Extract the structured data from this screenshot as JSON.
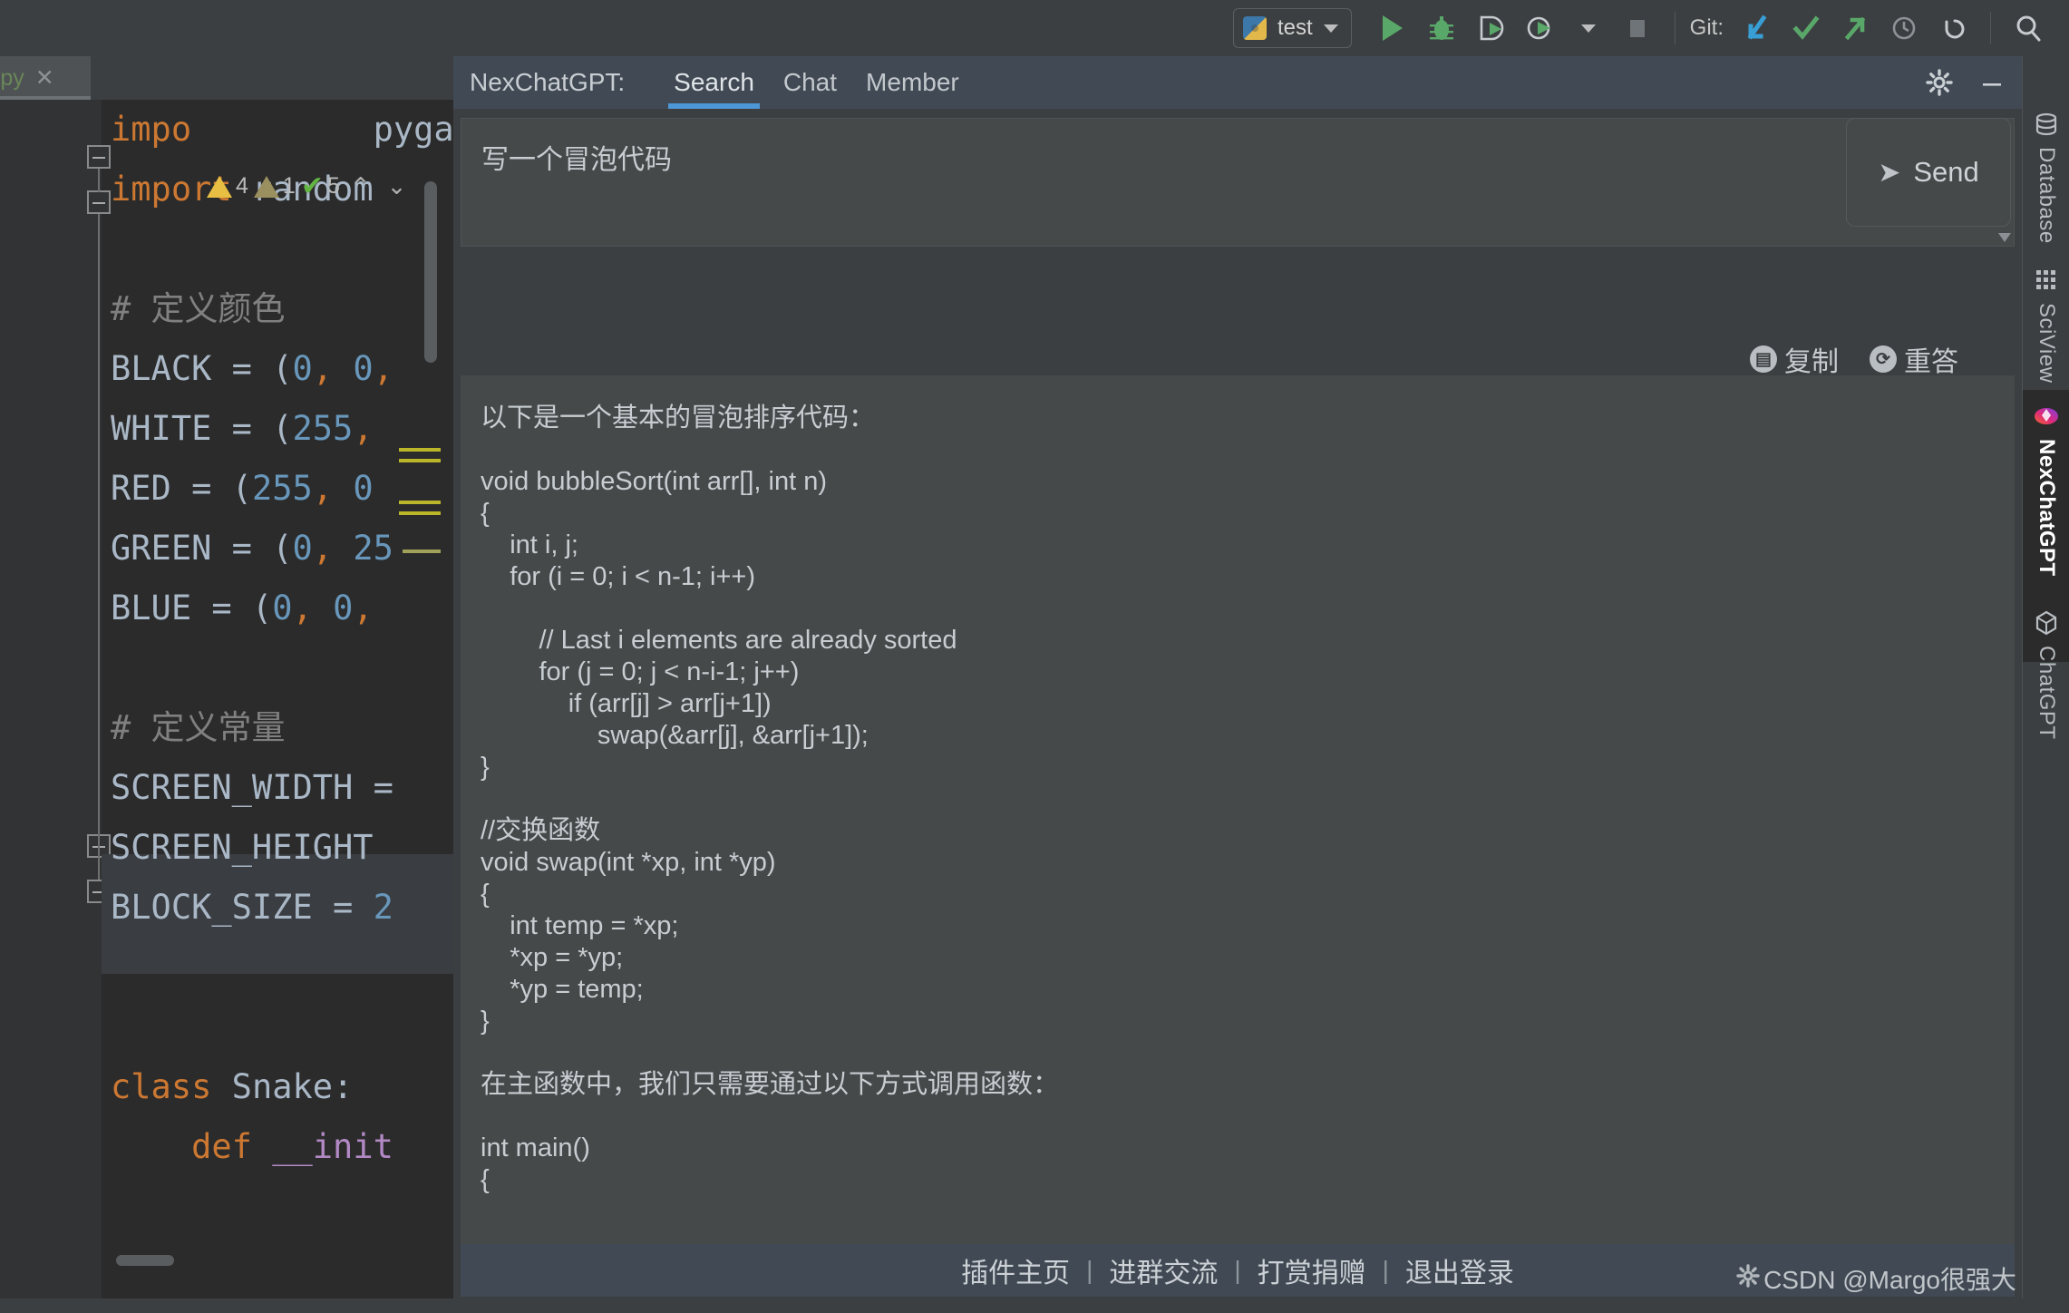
{
  "toolbar": {
    "run_config_label": "test",
    "git_label": "Git:",
    "icons": [
      {
        "name": "python-logo",
        "glyph": "py"
      },
      {
        "name": "run-button",
        "glyph": "▶"
      },
      {
        "name": "debug-button",
        "glyph": "bug"
      },
      {
        "name": "run-coverage-button",
        "glyph": "shield-run"
      },
      {
        "name": "profile-button",
        "glyph": "clock-run"
      },
      {
        "name": "stop-button",
        "glyph": "■"
      },
      {
        "name": "git-update-project",
        "glyph": "↙"
      },
      {
        "name": "git-commit",
        "glyph": "✓"
      },
      {
        "name": "git-push",
        "glyph": "↗"
      },
      {
        "name": "git-history",
        "glyph": "◷"
      },
      {
        "name": "git-rollback",
        "glyph": "↺"
      },
      {
        "name": "search-everywhere",
        "glyph": "⌕"
      }
    ]
  },
  "editor": {
    "tab_name": "st.py",
    "tab_close": "✕",
    "inspections": {
      "warnings": "4",
      "weak_warnings": "1",
      "checks": "5",
      "prev": "⌃",
      "next": "⌄"
    },
    "code_lines": [
      "impo         pyga   e",
      "import random",
      "",
      "# 定义颜色",
      "BLACK = (0, 0,",
      "WHITE = (255,",
      "RED = (255, 0",
      "GREEN = (0, 25",
      "BLUE = (0, 0,",
      "",
      "# 定义常量",
      "SCREEN_WIDTH =",
      "SCREEN_HEIGHT",
      "BLOCK_SIZE = 2",
      "",
      "",
      "class Snake:",
      "    def __init"
    ]
  },
  "panel": {
    "title": "NexChatGPT:",
    "tabs": [
      {
        "label": "Search",
        "active": true
      },
      {
        "label": "Chat",
        "active": false
      },
      {
        "label": "Member",
        "active": false
      }
    ],
    "settings_icon": "gear-icon",
    "minimize_icon": "minimize-icon",
    "input_value": "写一个冒泡代码",
    "input_placeholder": "",
    "send_label": "Send",
    "send_icon": "➤",
    "actions": [
      {
        "label": "复制",
        "icon": "copy-icon",
        "glyph": "▤"
      },
      {
        "label": "重答",
        "icon": "refresh-icon",
        "glyph": "⟳"
      }
    ],
    "answer_text": "以下是一个基本的冒泡排序代码：\n\nvoid bubbleSort(int arr[], int n)\n{\n    int i, j;\n    for (i = 0; i < n-1; i++)\n\n        // Last i elements are already sorted\n        for (j = 0; j < n-i-1; j++)\n            if (arr[j] > arr[j+1])\n                swap(&arr[j], &arr[j+1]);\n}\n\n//交换函数\nvoid swap(int *xp, int *yp)\n{\n    int temp = *xp;\n    *xp = *yp;\n    *yp = temp;\n}\n\n在主函数中，我们只需要通过以下方式调用函数：\n\nint main()\n{",
    "footer_links": [
      "插件主页",
      "进群交流",
      "打赏捐赠",
      "退出登录"
    ],
    "footer_separator": "|"
  },
  "right_stripe": {
    "tools": [
      {
        "label": "Database",
        "icon": "database-icon",
        "active": false
      },
      {
        "label": "SciView",
        "icon": "grid-icon",
        "active": false
      },
      {
        "label": "NexChatGPT",
        "icon": "nexchatgpt-icon",
        "active": true
      },
      {
        "label": "ChatGPT",
        "icon": "chatgpt-icon",
        "active": false
      }
    ]
  },
  "watermark": {
    "text": "CSDN @Margo很强大"
  },
  "colors": {
    "accent_blue": "#4e97d6",
    "panel_header": "#414a54",
    "panel_bg": "#45494a",
    "ide_bg": "#3c3f41",
    "editor_bg": "#2b2b2b",
    "keyword_orange": "#cc7832",
    "number_blue": "#6897bb",
    "text_grey": "#a9b7c6",
    "green_run": "#62b543"
  }
}
